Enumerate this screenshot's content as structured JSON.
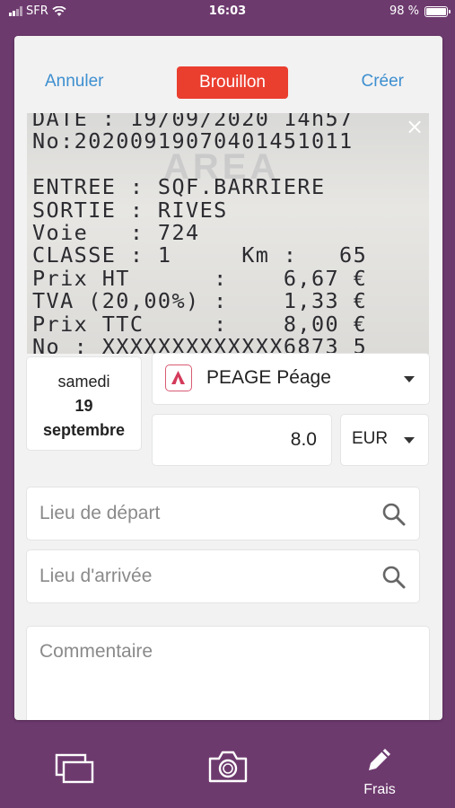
{
  "status_bar": {
    "carrier": "SFR",
    "time": "16:03",
    "battery": "98 %",
    "battery_level": 0.98
  },
  "header": {
    "cancel_label": "Annuler",
    "status_badge": "Brouillon",
    "create_label": "Créer"
  },
  "receipt_image": {
    "lines": [
      "DATE : 19/09/2020 14h57",
      "No:20200919070401451011",
      "",
      "ENTREE : SQF.BARRIERE",
      "SORTIE : RIVES",
      "Voie   : 724",
      "CLASSE : 1     Km :   65",
      "Prix HT      :    6,67 €",
      "TVA (20,00%) :    1,33 €",
      "Prix TTC     :    8,00 €",
      "No : XXXXXXXXXXXXX6873 5"
    ],
    "logo_text": "AREA"
  },
  "date": {
    "weekday": "samedi",
    "day": "19",
    "month": "septembre"
  },
  "category": {
    "label": "PEAGE Péage",
    "icon": "highway-icon",
    "icon_color": "#d43a5a"
  },
  "amount": {
    "value": "8.0",
    "currency": "EUR"
  },
  "fields": {
    "departure_placeholder": "Lieu de départ",
    "arrival_placeholder": "Lieu d'arrivée",
    "comment_placeholder": "Commentaire"
  },
  "tabbar": {
    "tab_expenses_icon": "stack-icon",
    "tab_camera_icon": "camera-icon",
    "tab_frais_label": "Frais",
    "tab_frais_icon": "pencil-icon"
  },
  "colors": {
    "brand": "#6d3a6e",
    "accent_link": "#3d8fd0",
    "draft_badge": "#ea3e2f"
  }
}
